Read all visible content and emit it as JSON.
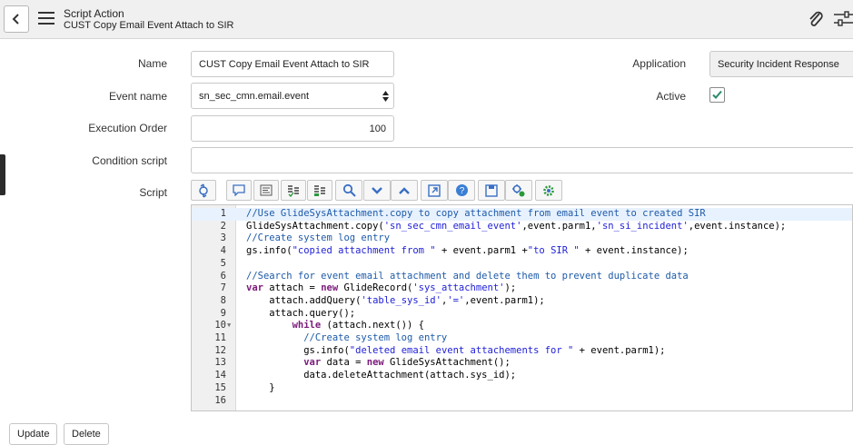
{
  "header": {
    "title": "Script Action",
    "subtitle": "CUST Copy Email Event Attach to SIR"
  },
  "form": {
    "name_label": "Name",
    "name_value": "CUST Copy Email Event Attach to SIR",
    "event_label": "Event name",
    "event_value": "sn_sec_cmn.email.event",
    "order_label": "Execution Order",
    "order_value": "100",
    "condition_label": "Condition script",
    "condition_value": "",
    "script_label": "Script",
    "application_label": "Application",
    "application_value": "Security Incident Response",
    "active_label": "Active",
    "active_checked": true
  },
  "toolbar_icons": [
    "sync-icon",
    "comment-icon",
    "format-icon",
    "toggle-comment-icon",
    "replace-icon",
    "search-icon",
    "collapse-icon",
    "expand-icon",
    "fullscreen-icon",
    "help-icon",
    "save-icon",
    "debug-icon",
    "settings-gear-icon"
  ],
  "code_lines": [
    {
      "n": "1",
      "text": "//Use GlideSysAttachment.copy to copy attachment from email event to created SIR"
    },
    {
      "n": "2",
      "text": "GlideSysAttachment.copy('sn_sec_cmn_email_event',event.parm1,'sn_si_incident',event.instance);"
    },
    {
      "n": "3",
      "text": "//Create system log entry"
    },
    {
      "n": "4",
      "text": "gs.info(\"copied attachment from \" + event.parm1 +\"to SIR \" + event.instance);"
    },
    {
      "n": "5",
      "text": ""
    },
    {
      "n": "6",
      "text": "//Search for event email attachment and delete them to prevent duplicate data"
    },
    {
      "n": "7",
      "text": "var attach = new GlideRecord('sys_attachment');"
    },
    {
      "n": "8",
      "text": "    attach.addQuery('table_sys_id','=',event.parm1);"
    },
    {
      "n": "9",
      "text": "    attach.query();"
    },
    {
      "n": "10",
      "text": "        while (attach.next()) {"
    },
    {
      "n": "11",
      "text": "          //Create system log entry"
    },
    {
      "n": "12",
      "text": "          gs.info(\"deleted email event attachements for \" + event.parm1);"
    },
    {
      "n": "13",
      "text": "          var data = new GlideSysAttachment();"
    },
    {
      "n": "14",
      "text": "          data.deleteAttachment(attach.sys_id);"
    },
    {
      "n": "15",
      "text": "    }"
    },
    {
      "n": "16",
      "text": ""
    }
  ],
  "buttons": {
    "update": "Update",
    "delete": "Delete"
  }
}
